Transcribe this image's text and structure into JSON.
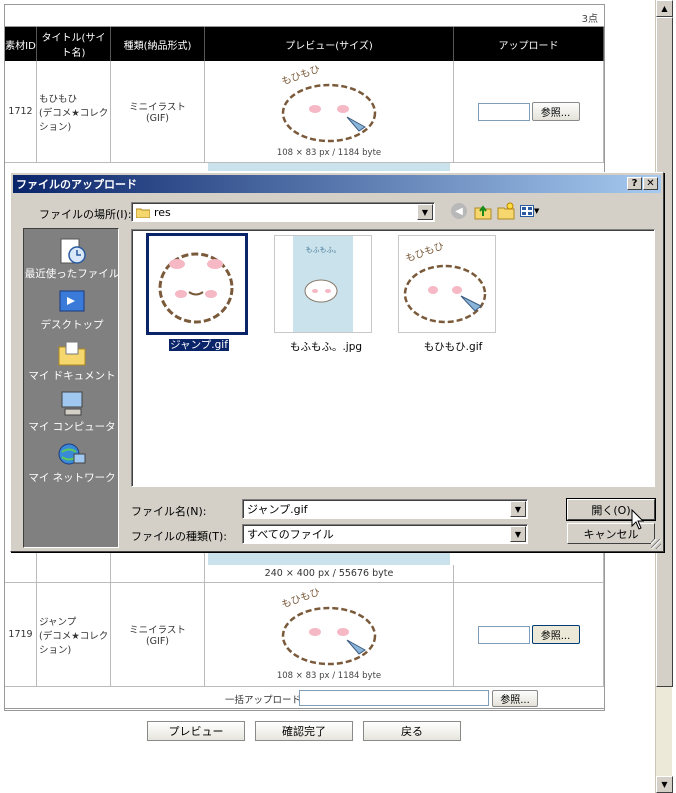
{
  "page": {
    "count": "3点",
    "headers": [
      "素材ID",
      "タイトル(サイト名)",
      "種類(納品形式)",
      "プレビュー(サイズ)",
      "アップロード"
    ],
    "rows": [
      {
        "id": "1712",
        "title": "もひもひ\n(デコメ★コレクション)",
        "type": "ミニイラスト\n(GIF)",
        "size": "108 × 83 px / 1184 byte",
        "browse": "参照..."
      },
      {
        "id": "",
        "title": "",
        "type": "",
        "size": "240 × 400 px / 55676 byte",
        "browse": ""
      },
      {
        "id": "1719",
        "title": "ジャンプ\n(デコメ★コレクション)",
        "type": "ミニイラスト\n(GIF)",
        "size": "108 × 83 px / 1184 byte",
        "browse": "参照..."
      }
    ],
    "bulk_label": "一括アップロード：",
    "bulk_browse": "参照...",
    "buttons": {
      "preview": "プレビュー",
      "confirm": "確認完了",
      "back": "戻る"
    }
  },
  "dialog": {
    "title": "ファイルのアップロード",
    "help": "?",
    "close": "✕",
    "lookin_label": "ファイルの場所(I):",
    "lookin_value": "res",
    "places": [
      "最近使ったファイル",
      "デスクトップ",
      "マイ ドキュメント",
      "マイ コンピュータ",
      "マイ ネットワーク"
    ],
    "files": [
      "ジャンプ.gif",
      "もふもふ。.jpg",
      "もひもひ.gif"
    ],
    "thumb_text": "もひもひ",
    "mofu_text": "もふもふ。",
    "filename_label": "ファイル名(N):",
    "filename_value": "ジャンプ.gif",
    "filetype_label": "ファイルの種類(T):",
    "filetype_value": "すべてのファイル",
    "open": "開く(O)",
    "cancel": "キャンセル"
  },
  "colors": {
    "titlebar": "#0a246a",
    "selection": "#0a246a",
    "places_bg": "#808080",
    "light_blue": "#c9e2ec"
  },
  "icons": [
    "folder-icon",
    "back-icon",
    "up-folder-icon",
    "new-folder-icon",
    "view-menu-icon",
    "recent-icon",
    "desktop-icon",
    "documents-icon",
    "computer-icon",
    "network-icon",
    "cursor-icon"
  ]
}
